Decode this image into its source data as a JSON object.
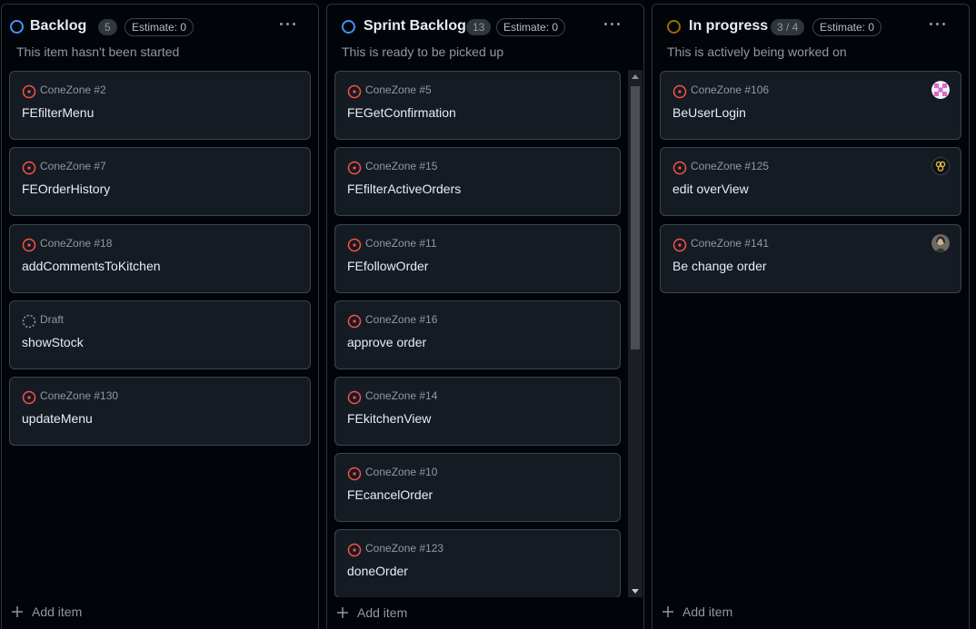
{
  "columns": [
    {
      "title": "Backlog",
      "count": "5",
      "estimate": "Estimate: 0",
      "description": "This item hasn't been started",
      "status_color": "#4493f8",
      "add_item_label": "Add item",
      "cards": [
        {
          "meta": "ConeZone #2",
          "title": "FEfilterMenu",
          "kind": "issue"
        },
        {
          "meta": "ConeZone #7",
          "title": "FEOrderHistory",
          "kind": "issue"
        },
        {
          "meta": "ConeZone #18",
          "title": "addCommentsToKitchen",
          "kind": "issue"
        },
        {
          "meta": "Draft",
          "title": "showStock",
          "kind": "draft"
        },
        {
          "meta": "ConeZone #130",
          "title": "updateMenu",
          "kind": "issue"
        }
      ]
    },
    {
      "title": "Sprint Backlog",
      "count": "13",
      "estimate": "Estimate: 0",
      "description": "This is ready to be picked up",
      "status_color": "#4493f8",
      "add_item_label": "Add item",
      "cards": [
        {
          "meta": "ConeZone #5",
          "title": "FEGetConfirmation",
          "kind": "issue"
        },
        {
          "meta": "ConeZone #15",
          "title": "FEfilterActiveOrders",
          "kind": "issue"
        },
        {
          "meta": "ConeZone #11",
          "title": "FEfollowOrder",
          "kind": "issue"
        },
        {
          "meta": "ConeZone #16",
          "title": "approve order",
          "kind": "issue"
        },
        {
          "meta": "ConeZone #14",
          "title": "FEkitchenView",
          "kind": "issue"
        },
        {
          "meta": "ConeZone #10",
          "title": "FEcancelOrder",
          "kind": "issue"
        },
        {
          "meta": "ConeZone #123",
          "title": "doneOrder",
          "kind": "issue"
        }
      ]
    },
    {
      "title": "In progress",
      "count": "3 / 4",
      "estimate": "Estimate: 0",
      "description": "This is actively being worked on",
      "status_color": "#9e6a03",
      "add_item_label": "Add item",
      "cards": [
        {
          "meta": "ConeZone #106",
          "title": "BeUserLogin",
          "kind": "issue",
          "avatar": "pink-pattern-avatar"
        },
        {
          "meta": "ConeZone #125",
          "title": "edit overView",
          "kind": "issue",
          "avatar": "yellow-logo-avatar"
        },
        {
          "meta": "ConeZone #141",
          "title": "Be change order",
          "kind": "issue",
          "avatar": "photo-avatar"
        }
      ]
    }
  ],
  "colors": {
    "open_issue": "#f85149",
    "draft": "#9198a1",
    "background": "#010409",
    "card": "#151b23",
    "border": "#3d444d"
  },
  "icons": {
    "issue": "issue-opened-icon",
    "draft": "issue-draft-icon",
    "plus": "plus-icon",
    "more": "kebab-horizontal-icon",
    "status": "status-circle-icon"
  }
}
